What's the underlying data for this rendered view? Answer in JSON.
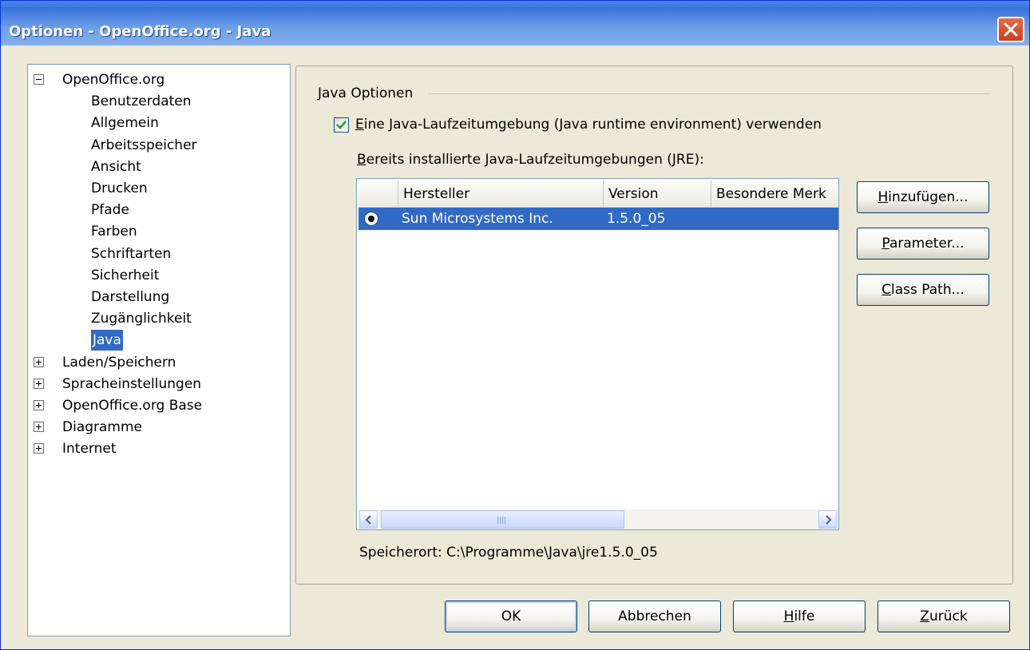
{
  "window": {
    "title": "Optionen - OpenOffice.org - Java"
  },
  "tree": {
    "root": {
      "label": "OpenOffice.org",
      "expanded": true
    },
    "children": [
      "Benutzerdaten",
      "Allgemein",
      "Arbeitsspeicher",
      "Ansicht",
      "Drucken",
      "Pfade",
      "Farben",
      "Schriftarten",
      "Sicherheit",
      "Darstellung",
      "Zugänglichkeit",
      "Java"
    ],
    "selected": "Java",
    "collapsed": [
      "Laden/Speichern",
      "Spracheinstellungen",
      "OpenOffice.org Base",
      "Diagramme",
      "Internet"
    ]
  },
  "java": {
    "group_title": "Java Optionen",
    "use_jre": {
      "label_accel": "E",
      "label_rest": "ine Java-Laufzeitumgebung (Java runtime environment) verwenden",
      "checked": true
    },
    "installed_label": {
      "accel": "B",
      "rest": "ereits installierte Java-Laufzeitumgebungen (JRE):"
    },
    "columns": [
      "Hersteller",
      "Version",
      "Besondere Merk"
    ],
    "rows": [
      {
        "vendor": "Sun Microsystems Inc.",
        "version": "1.5.0_05",
        "features": "",
        "selected": true
      }
    ],
    "location": "Speicherort: C:\\Programme\\Java\\jre1.5.0_05"
  },
  "side_buttons": {
    "add": {
      "accel": "H",
      "rest": "inzufügen..."
    },
    "params": {
      "accel": "P",
      "rest": "arameter..."
    },
    "classpath": {
      "accel": "C",
      "rest": "lass Path..."
    }
  },
  "footer": {
    "ok": "OK",
    "cancel": "Abbrechen",
    "help": {
      "accel": "H",
      "rest": "ilfe"
    },
    "reset": {
      "accel": "Z",
      "rest": "urück"
    }
  }
}
